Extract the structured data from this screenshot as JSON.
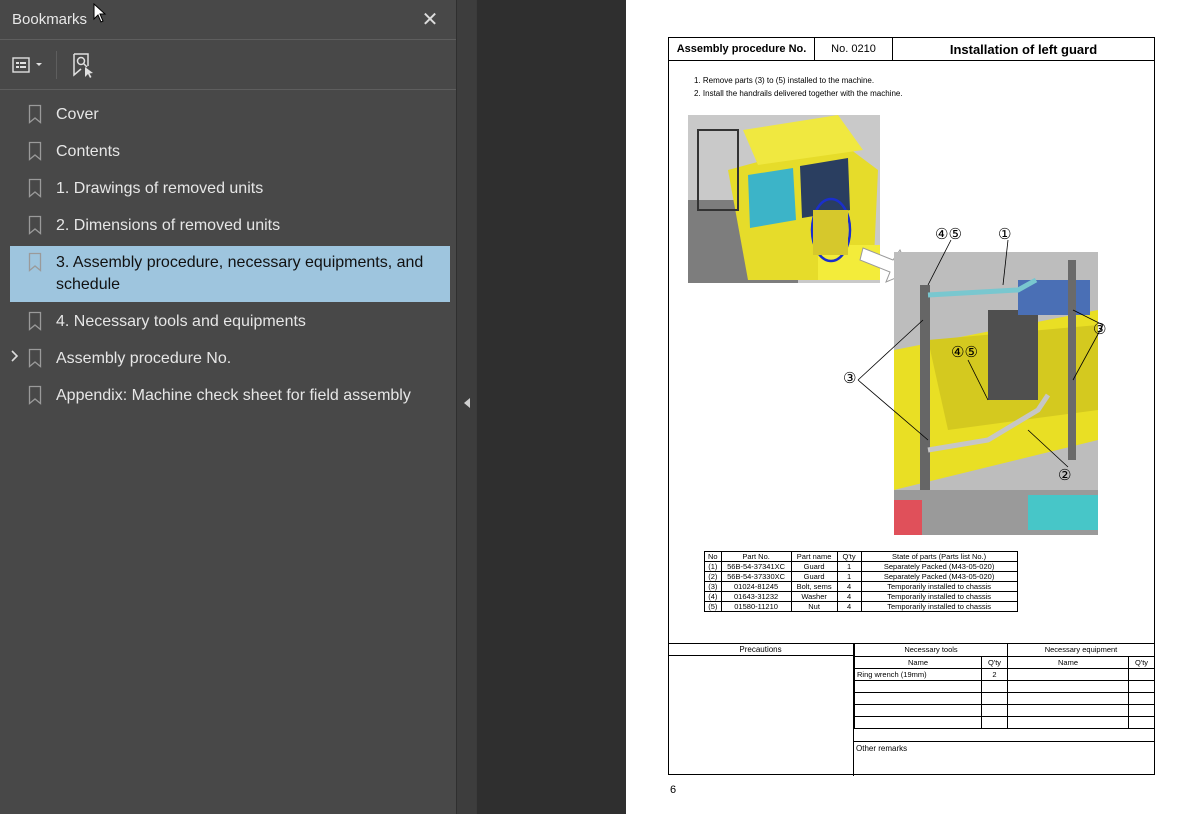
{
  "sidebar": {
    "title": "Bookmarks",
    "close_glyph": "✕",
    "items": [
      {
        "label": "Cover",
        "selected": false,
        "expandable": false
      },
      {
        "label": "Contents",
        "selected": false,
        "expandable": false
      },
      {
        "label": "1. Drawings of removed units",
        "selected": false,
        "expandable": false
      },
      {
        "label": "2. Dimensions of removed units",
        "selected": false,
        "expandable": false
      },
      {
        "label": "3. Assembly procedure, necessary equipments, and schedule",
        "selected": true,
        "expandable": false
      },
      {
        "label": "4. Necessary tools and equipments",
        "selected": false,
        "expandable": false
      },
      {
        "label": "Assembly procedure No.",
        "selected": false,
        "expandable": true
      },
      {
        "label": "Appendix: Machine check sheet for field assembly",
        "selected": false,
        "expandable": false
      }
    ],
    "selected_color": "#9ec5de"
  },
  "document": {
    "header": {
      "col1": "Assembly procedure No.",
      "col2": "No. 0210",
      "col3": "Installation of left guard"
    },
    "instructions": [
      "1. Remove parts (3) to (5) installed to the machine.",
      "2. Install the handrails delivered together with the machine."
    ],
    "callouts": {
      "c45a": "④⑤",
      "c1": "①",
      "c3a": "③",
      "c45b": "④⑤",
      "c3b": "③",
      "c2": "②"
    },
    "parts_table": {
      "headers": [
        "No",
        "Part No.",
        "Part name",
        "Q'ty",
        "State of parts (Parts list No.)"
      ],
      "rows": [
        [
          "(1)",
          "56B-54-37341XC",
          "Guard",
          "1",
          "Separately Packed (M43-05-020)"
        ],
        [
          "(2)",
          "56B-54-37330XC",
          "Guard",
          "1",
          "Separately Packed (M43-05-020)"
        ],
        [
          "(3)",
          "01024-81245",
          "Bolt, sems",
          "4",
          "Temporarily  installed to chassis"
        ],
        [
          "(4)",
          "01643-31232",
          "Washer",
          "4",
          "Temporarily  installed to chassis"
        ],
        [
          "(5)",
          "01580-11210",
          "Nut",
          "4",
          "Temporarily  installed to chassis"
        ]
      ]
    },
    "bottom": {
      "precautions": "Precautions",
      "tools_title": "Necessary tools",
      "equip_title": "Necessary equipment",
      "name": "Name",
      "qty": "Q'ty",
      "tool_row": [
        "Ring wrench (19mm)",
        "2"
      ],
      "other_remarks": "Other remarks"
    },
    "page_number": "6"
  }
}
